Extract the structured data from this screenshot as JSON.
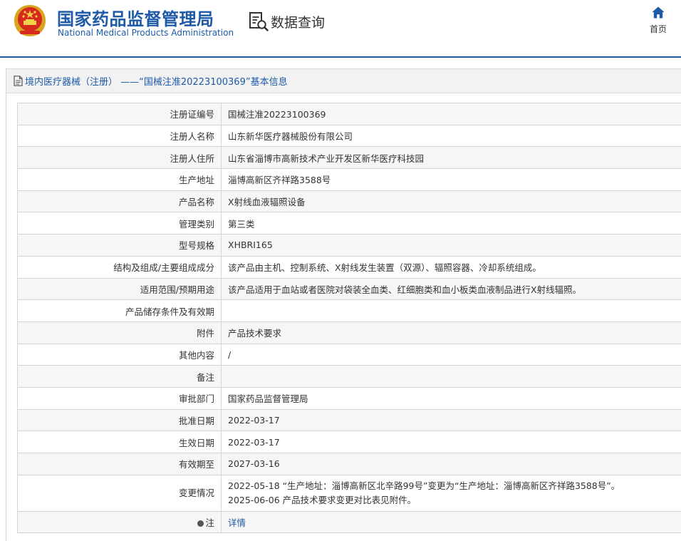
{
  "header": {
    "org_name_cn": "国家药品监督管理局",
    "org_name_en": "National Medical Products Administration",
    "emblem_icon": "national-emblem-icon",
    "query_icon": "document-search-icon",
    "query_label": "数据查询",
    "home_icon": "home-icon",
    "home_label": "首页"
  },
  "panel": {
    "title_icon": "document-icon",
    "title": "境内医疗器械（注册） ——“国械注准20223100369”基本信息"
  },
  "rows": [
    {
      "label": "注册证编号",
      "value": "国械注准20223100369"
    },
    {
      "label": "注册人名称",
      "value": "山东新华医疗器械股份有限公司"
    },
    {
      "label": "注册人住所",
      "value": "山东省淄博市高新技术产业开发区新华医疗科技园"
    },
    {
      "label": "生产地址",
      "value": "淄博高新区齐祥路3588号"
    },
    {
      "label": "产品名称",
      "value": "X射线血液辐照设备"
    },
    {
      "label": "管理类别",
      "value": "第三类"
    },
    {
      "label": "型号规格",
      "value": "XHBRI165"
    },
    {
      "label": "结构及组成/主要组成成分",
      "value": "该产品由主机、控制系统、X射线发生装置（双源）、辐照容器、冷却系统组成。"
    },
    {
      "label": "适用范围/预期用途",
      "value": "该产品适用于血站或者医院对袋装全血类、红细胞类和血小板类血液制品进行X射线辐照。"
    },
    {
      "label": "产品储存条件及有效期",
      "value": ""
    },
    {
      "label": "附件",
      "value": "产品技术要求"
    },
    {
      "label": "其他内容",
      "value": "/"
    },
    {
      "label": "备注",
      "value": ""
    },
    {
      "label": "审批部门",
      "value": "国家药品监督管理局"
    },
    {
      "label": "批准日期",
      "value": "2022-03-17"
    },
    {
      "label": "生效日期",
      "value": "2022-03-17"
    },
    {
      "label": "有效期至",
      "value": "2027-03-16"
    }
  ],
  "change": {
    "label": "变更情况",
    "line1": "2022-05-18 “生产地址：淄博高新区北辛路99号”变更为“生产地址：淄博高新区齐祥路3588号”。",
    "line2": "2025-06-06 产品技术要求变更对比表见附件。"
  },
  "note": {
    "icon": "note-dot-icon",
    "label": "注",
    "link_text": "详情"
  }
}
